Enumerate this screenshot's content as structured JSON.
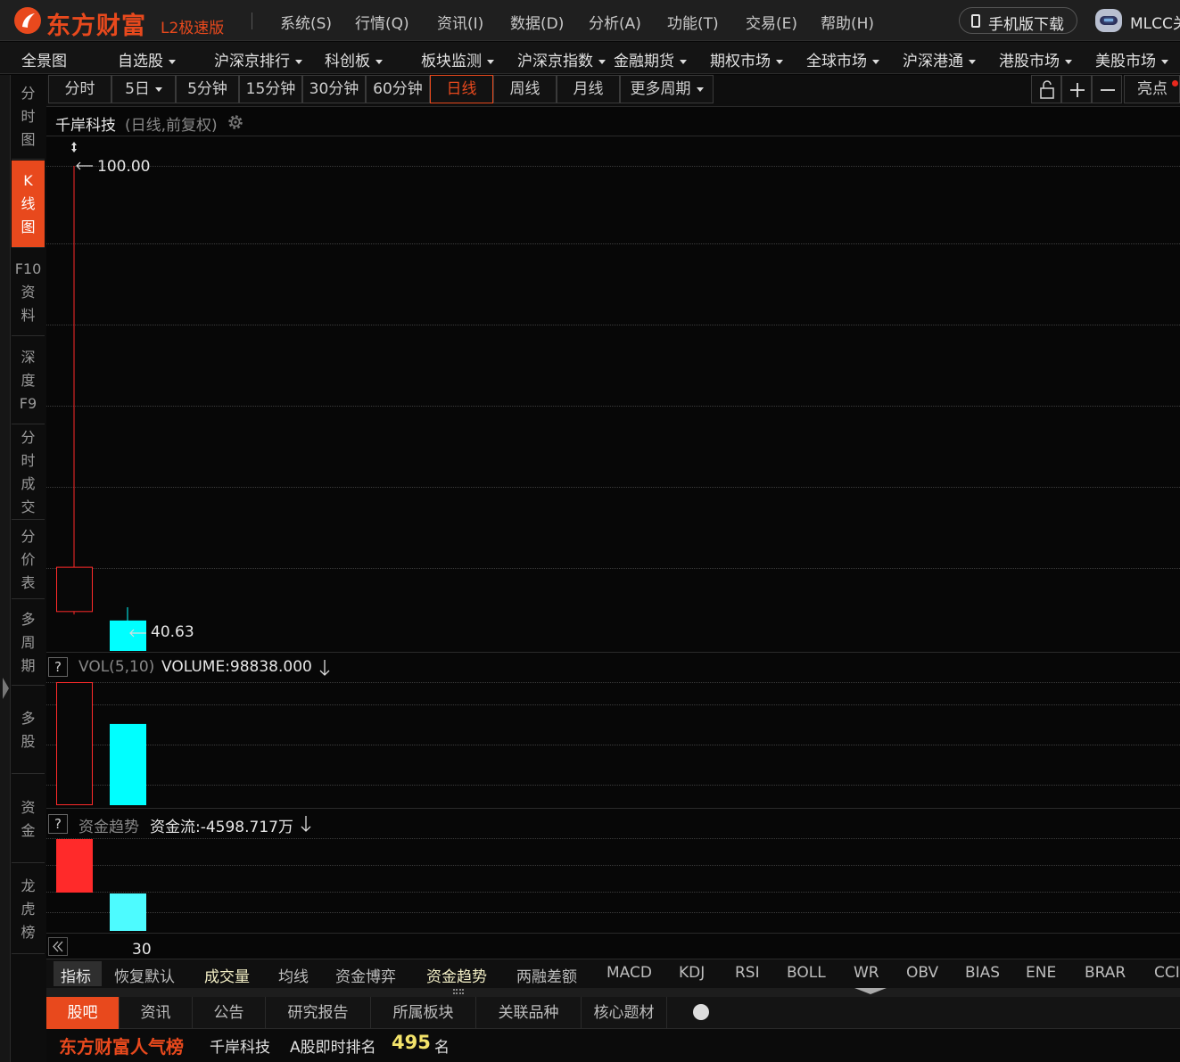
{
  "app": {
    "brand": "东方财富",
    "edition": "L2极速版"
  },
  "menu": [
    "系统(S)",
    "行情(Q)",
    "资讯(I)",
    "数据(D)",
    "分析(A)",
    "功能(T)",
    "交易(E)",
    "帮助(H)"
  ],
  "header_right": {
    "mobile_label": "手机版下载",
    "user": "MLCC关"
  },
  "nav": [
    {
      "label": "全景图"
    },
    {
      "label": "自选股"
    },
    {
      "label": "沪深京排行"
    },
    {
      "label": "科创板"
    },
    {
      "label": "板块监测"
    },
    {
      "label": "沪深京指数"
    },
    {
      "label": "金融期货"
    },
    {
      "label": "期权市场"
    },
    {
      "label": "全球市场"
    },
    {
      "label": "沪深港通"
    },
    {
      "label": "港股市场"
    },
    {
      "label": "美股市场"
    }
  ],
  "sidebar": [
    {
      "chars": [
        "分",
        "时",
        "图"
      ]
    },
    {
      "chars": [
        "K",
        "线",
        "图"
      ],
      "active": true
    },
    {
      "chars": [
        "F10",
        "资",
        "料"
      ]
    },
    {
      "chars": [
        "深",
        "度",
        "F9"
      ]
    },
    {
      "chars": [
        "分",
        "时",
        "成",
        "交"
      ]
    },
    {
      "chars": [
        "分",
        "价",
        "表"
      ]
    },
    {
      "chars": [
        "多",
        "周",
        "期"
      ]
    },
    {
      "chars": [
        "多",
        "股"
      ]
    },
    {
      "chars": [
        "资",
        "金"
      ]
    },
    {
      "chars": [
        "龙",
        "虎",
        "榜"
      ]
    }
  ],
  "periods": [
    {
      "label": "分时"
    },
    {
      "label": "5日",
      "dropdown": true
    },
    {
      "label": "5分钟"
    },
    {
      "label": "15分钟"
    },
    {
      "label": "30分钟"
    },
    {
      "label": "60分钟"
    },
    {
      "label": "日线",
      "active": true
    },
    {
      "label": "周线"
    },
    {
      "label": "月线"
    },
    {
      "label": "更多周期",
      "dropdown": true
    }
  ],
  "toolbar": {
    "liangdian": "亮点"
  },
  "stock": {
    "name": "千岸科技",
    "subtitle": "(日线,前复权)"
  },
  "chart_data": {
    "type": "candlestick",
    "ylim": [
      40.63,
      100.0
    ],
    "price_labels": {
      "high": "100.00",
      "low": "40.63"
    },
    "candles": [
      {
        "open": 43.37,
        "close": 49.0,
        "high": 100.0,
        "low": 43.0
      },
      {
        "open": 42.23,
        "close": 37.0,
        "high": 43.91,
        "low": 36.9
      }
    ],
    "volume": {
      "label": "VOL(5,10)",
      "readout": "VOLUME:98838.000",
      "bars": [
        {
          "value": 1.0,
          "up": true
        },
        {
          "value": 0.66,
          "up": false
        }
      ]
    },
    "fund_flow": {
      "label": "资金趋势",
      "readout": "资金流:-4598.717万",
      "bars": [
        {
          "value": 1.0,
          "positive": true
        },
        {
          "value": 0.7,
          "positive": false
        }
      ],
      "axis_label": "30"
    }
  },
  "indicator_tabs": [
    {
      "label": "指标",
      "active": true
    },
    {
      "label": "恢复默认"
    },
    {
      "label": "成交量",
      "hl": true
    },
    {
      "label": "均线"
    },
    {
      "label": "资金博弈"
    },
    {
      "label": "资金趋势",
      "hl": true
    },
    {
      "label": "两融差额"
    },
    {
      "label": "MACD"
    },
    {
      "label": "KDJ"
    },
    {
      "label": "RSI"
    },
    {
      "label": "BOLL"
    },
    {
      "label": "WR"
    },
    {
      "label": "OBV"
    },
    {
      "label": "BIAS"
    },
    {
      "label": "ENE"
    },
    {
      "label": "BRAR"
    },
    {
      "label": "CCI"
    }
  ],
  "info_tabs": [
    {
      "label": "股吧",
      "active": true
    },
    {
      "label": "资讯"
    },
    {
      "label": "公告"
    },
    {
      "label": "研究报告"
    },
    {
      "label": "所属板块"
    },
    {
      "label": "关联品种"
    },
    {
      "label": "核心题材"
    }
  ],
  "ranking": {
    "title": "东方财富人气榜",
    "stock": "千岸科技",
    "label": "A股即时排名",
    "rank": "495",
    "unit": "名"
  },
  "colors": {
    "accent": "#e8491d",
    "up": "#ff2a2a",
    "down": "#00ffff",
    "down_light": "#4dfbff",
    "rank": "#f3e36a"
  }
}
